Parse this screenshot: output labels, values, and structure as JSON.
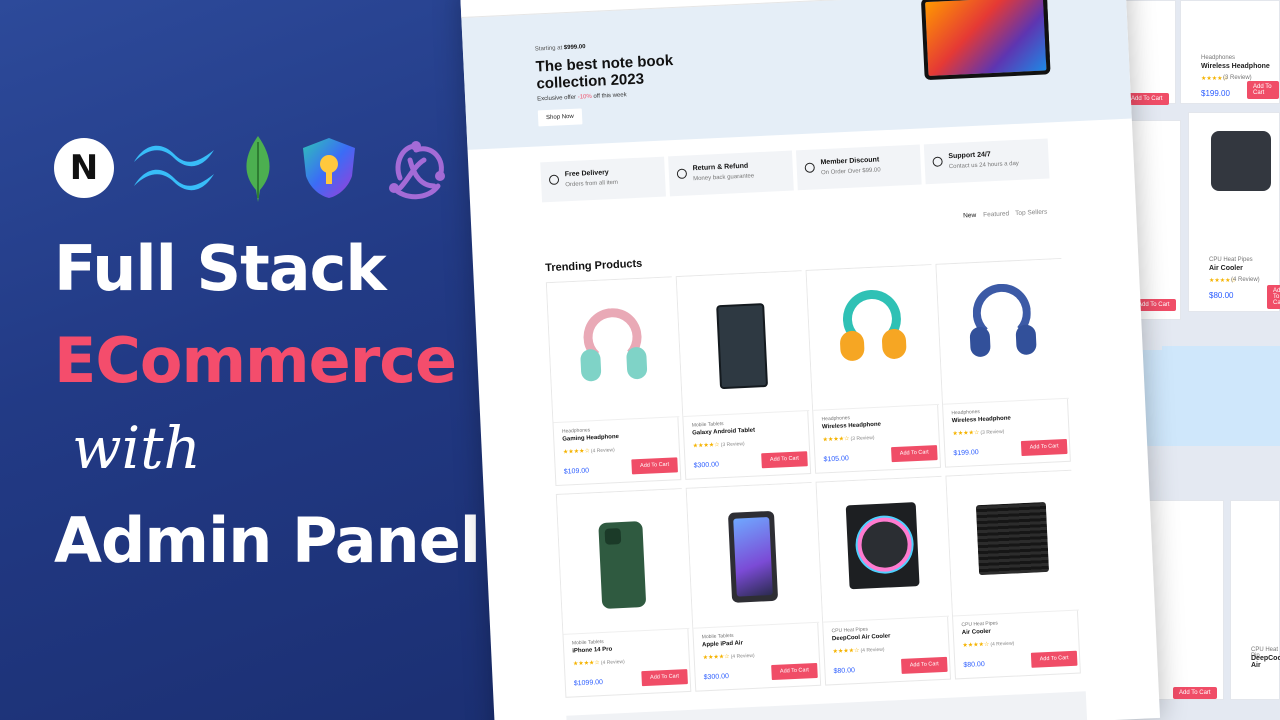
{
  "banner": {
    "line1": "Full Stack",
    "line2": "ECommerce",
    "line3": "with",
    "line4": "Admin Panel",
    "logos": [
      "nextjs-logo",
      "tailwind-logo",
      "mongodb-logo",
      "auth-shield-logo",
      "redux-logo"
    ],
    "next_letter": "N"
  },
  "colors": {
    "banner_bg": "#2d4a9a",
    "accent": "#f44d6c",
    "price": "#2a5cff",
    "button": "#f04d67"
  },
  "hero": {
    "starting_prefix": "Starting at",
    "starting_price": "$999.00",
    "title": "The best note book collection 2023",
    "offer_prefix": "Exclusive offer",
    "offer_pct": "-10%",
    "offer_suffix": "off this week",
    "shop_button": "Shop Now"
  },
  "features": [
    {
      "title": "Free Delivery",
      "subtitle": "Orders from all item"
    },
    {
      "title": "Return & Refund",
      "subtitle": "Money back guarantee"
    },
    {
      "title": "Member Discount",
      "subtitle": "On Order Over $99.00"
    },
    {
      "title": "Support 24/7",
      "subtitle": "Contact us 24 hours a day"
    }
  ],
  "tabs": [
    "New",
    "Featured",
    "Top Sellers"
  ],
  "section_title": "Trending Products",
  "add_to_cart": "Add To Cart",
  "products": [
    {
      "category": "Headphones",
      "name": "Gaming Headphone",
      "reviews": "(4 Review)",
      "price": "$109.00",
      "image": "pink-headphone"
    },
    {
      "category": "Mobile Tablets",
      "name": "Galaxy Android Tablet",
      "reviews": "(3 Review)",
      "price": "$300.00",
      "image": "fold-phone"
    },
    {
      "category": "Headphones",
      "name": "Wireless Headphone",
      "reviews": "(3 Review)",
      "price": "$105.00",
      "image": "kids-headphone"
    },
    {
      "category": "Headphones",
      "name": "Wireless Headphone",
      "reviews": "(3 Review)",
      "price": "$199.00",
      "image": "blue-headphone"
    },
    {
      "category": "Mobile Tablets",
      "name": "iPhone 14 Pro",
      "reviews": "(4 Review)",
      "price": "$1099.00",
      "image": "green-iphone"
    },
    {
      "category": "Mobile Tablets",
      "name": "Apple iPad Air",
      "reviews": "(4 Review)",
      "price": "$300.00",
      "image": "ipad"
    },
    {
      "category": "CPU Heat Pipes",
      "name": "DeepCool Air Cooler",
      "reviews": "(4 Review)",
      "price": "$80.00",
      "image": "rgb-cooler"
    },
    {
      "category": "CPU Heat Pipes",
      "name": "Air Cooler",
      "reviews": "(4 Review)",
      "price": "$80.00",
      "image": "black-cooler"
    }
  ],
  "side_cards": [
    {
      "category": "Headphones",
      "name": "Wireless Headphone",
      "price": "$199.00",
      "reviews": "(3 Review)"
    },
    {
      "category": "CPU Heat Pipes",
      "name": "Air Cooler",
      "price": "$80.00",
      "reviews": "(4 Review)"
    },
    {
      "category": "CPU Heat Pip",
      "name": "DeepCool Air"
    }
  ],
  "stars": "★★★★☆"
}
